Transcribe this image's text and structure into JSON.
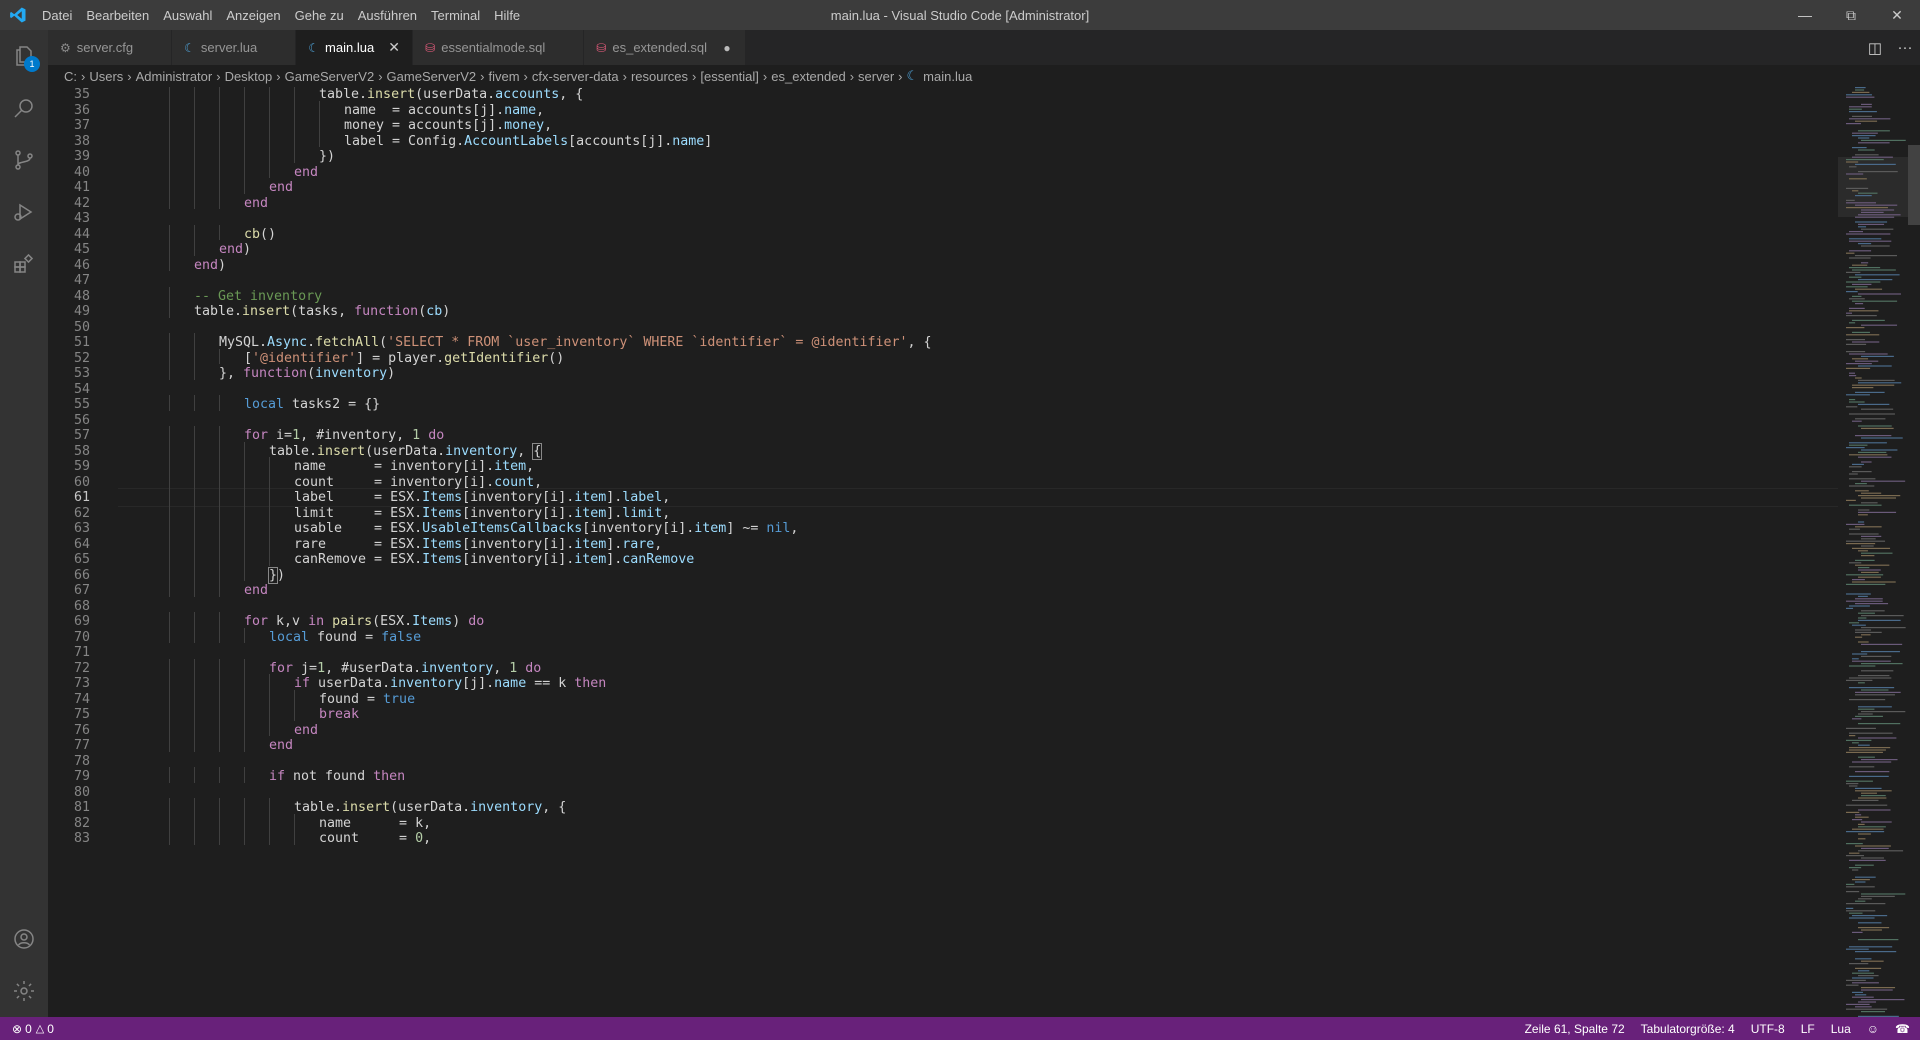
{
  "window": {
    "title": "main.lua - Visual Studio Code [Administrator]",
    "menu": [
      "Datei",
      "Bearbeiten",
      "Auswahl",
      "Anzeigen",
      "Gehe zu",
      "Ausführen",
      "Terminal",
      "Hilfe"
    ]
  },
  "activity_bar": {
    "explorer_badge": "1"
  },
  "tabs": [
    {
      "label": "server.cfg",
      "icon": "gear-icon",
      "state": "inactive"
    },
    {
      "label": "server.lua",
      "icon": "lua-moon-icon",
      "state": "inactive"
    },
    {
      "label": "main.lua",
      "icon": "lua-moon-icon",
      "state": "active"
    },
    {
      "label": "essentialmode.sql",
      "icon": "database-icon",
      "state": "inactive"
    },
    {
      "label": "es_extended.sql",
      "icon": "database-icon",
      "state": "modified"
    }
  ],
  "breadcrumb": [
    "C:",
    "Users",
    "Administrator",
    "Desktop",
    "GameServerV2",
    "GameServerV2",
    "fivem",
    "cfx-server-data",
    "resources",
    "[essential]",
    "es_extended",
    "server",
    "main.lua"
  ],
  "editor": {
    "current_line": 61,
    "lines": [
      {
        "n": "35",
        "i": 7,
        "t": [
          [
            "table",
            "id"
          ],
          [
            ".",
            "id"
          ],
          [
            "insert",
            "fn"
          ],
          [
            "(userData.",
            "id"
          ],
          [
            "accounts",
            "prop"
          ],
          [
            ", {",
            "id"
          ]
        ]
      },
      {
        "n": "36",
        "i": 8,
        "t": [
          [
            "name  = accounts[j].",
            "id"
          ],
          [
            "name",
            "prop"
          ],
          [
            ",",
            "id"
          ]
        ]
      },
      {
        "n": "37",
        "i": 8,
        "t": [
          [
            "money = accounts[j].",
            "id"
          ],
          [
            "money",
            "prop"
          ],
          [
            ",",
            "id"
          ]
        ]
      },
      {
        "n": "38",
        "i": 8,
        "t": [
          [
            "label = Config.",
            "id"
          ],
          [
            "AccountLabels",
            "prop"
          ],
          [
            "[accounts[j].",
            "id"
          ],
          [
            "name",
            "prop"
          ],
          [
            "]",
            "id"
          ]
        ]
      },
      {
        "n": "39",
        "i": 7,
        "t": [
          [
            "})",
            "id"
          ]
        ]
      },
      {
        "n": "40",
        "i": 6,
        "t": [
          [
            "end",
            "kw"
          ]
        ]
      },
      {
        "n": "41",
        "i": 5,
        "t": [
          [
            "end",
            "kw"
          ]
        ]
      },
      {
        "n": "42",
        "i": 4,
        "t": [
          [
            "end",
            "kw"
          ]
        ]
      },
      {
        "n": "43",
        "i": 0,
        "t": []
      },
      {
        "n": "44",
        "i": 4,
        "t": [
          [
            "cb",
            "fn"
          ],
          [
            "()",
            "id"
          ]
        ]
      },
      {
        "n": "45",
        "i": 3,
        "t": [
          [
            "end",
            "kw"
          ],
          [
            ")",
            "id"
          ]
        ]
      },
      {
        "n": "46",
        "i": 2,
        "t": [
          [
            "end",
            "kw"
          ],
          [
            ")",
            "id"
          ]
        ]
      },
      {
        "n": "47",
        "i": 0,
        "t": []
      },
      {
        "n": "48",
        "i": 2,
        "t": [
          [
            "-- Get inventory",
            "cm"
          ]
        ]
      },
      {
        "n": "49",
        "i": 2,
        "t": [
          [
            "table",
            "id"
          ],
          [
            ".",
            "id"
          ],
          [
            "insert",
            "fn"
          ],
          [
            "(tasks, ",
            "id"
          ],
          [
            "function",
            "kw"
          ],
          [
            "(",
            "id"
          ],
          [
            "cb",
            "prop"
          ],
          [
            ")",
            "id"
          ]
        ]
      },
      {
        "n": "50",
        "i": 0,
        "t": []
      },
      {
        "n": "51",
        "i": 3,
        "t": [
          [
            "MySQL.",
            "id"
          ],
          [
            "Async",
            "prop"
          ],
          [
            ".",
            "id"
          ],
          [
            "fetchAll",
            "fn"
          ],
          [
            "(",
            "id"
          ],
          [
            "'SELECT * FROM `user_inventory` WHERE `identifier` = @identifier'",
            "str"
          ],
          [
            ", {",
            "id"
          ]
        ]
      },
      {
        "n": "52",
        "i": 4,
        "t": [
          [
            "[",
            "id"
          ],
          [
            "'@identifier'",
            "str"
          ],
          [
            "] = player.",
            "id"
          ],
          [
            "getIdentifier",
            "fn"
          ],
          [
            "()",
            "id"
          ]
        ]
      },
      {
        "n": "53",
        "i": 3,
        "t": [
          [
            "}, ",
            "id"
          ],
          [
            "function",
            "kw"
          ],
          [
            "(",
            "id"
          ],
          [
            "inventory",
            "prop"
          ],
          [
            ")",
            "id"
          ]
        ]
      },
      {
        "n": "54",
        "i": 0,
        "t": []
      },
      {
        "n": "55",
        "i": 4,
        "t": [
          [
            "local",
            "kb"
          ],
          [
            " tasks2 = {}",
            "id"
          ]
        ]
      },
      {
        "n": "56",
        "i": 0,
        "t": []
      },
      {
        "n": "57",
        "i": 4,
        "t": [
          [
            "for",
            "kw"
          ],
          [
            " i=",
            "id"
          ],
          [
            "1",
            "num"
          ],
          [
            ", #inventory, ",
            "id"
          ],
          [
            "1",
            "num"
          ],
          [
            " ",
            "id"
          ],
          [
            "do",
            "kw"
          ]
        ]
      },
      {
        "n": "58",
        "i": 5,
        "t": [
          [
            "table",
            "id"
          ],
          [
            ".",
            "id"
          ],
          [
            "insert",
            "fn"
          ],
          [
            "(userData.",
            "id"
          ],
          [
            "inventory",
            "prop"
          ],
          [
            ", ",
            "id"
          ],
          [
            "{",
            "bc"
          ]
        ]
      },
      {
        "n": "59",
        "i": 6,
        "t": [
          [
            "name      = inventory[i].",
            "id"
          ],
          [
            "item",
            "prop"
          ],
          [
            ",",
            "id"
          ]
        ]
      },
      {
        "n": "60",
        "i": 6,
        "t": [
          [
            "count     = inventory[i].",
            "id"
          ],
          [
            "count",
            "prop"
          ],
          [
            ",",
            "id"
          ]
        ]
      },
      {
        "n": "61",
        "i": 6,
        "t": [
          [
            "label     = ESX.",
            "id"
          ],
          [
            "Items",
            "prop"
          ],
          [
            "[inventory[i].",
            "id"
          ],
          [
            "item",
            "prop"
          ],
          [
            "].",
            "id"
          ],
          [
            "label",
            "prop"
          ],
          [
            ",",
            "id"
          ]
        ]
      },
      {
        "n": "62",
        "i": 6,
        "t": [
          [
            "limit     = ESX.",
            "id"
          ],
          [
            "Items",
            "prop"
          ],
          [
            "[inventory[i].",
            "id"
          ],
          [
            "item",
            "prop"
          ],
          [
            "].",
            "id"
          ],
          [
            "limit",
            "prop"
          ],
          [
            ",",
            "id"
          ]
        ]
      },
      {
        "n": "63",
        "i": 6,
        "t": [
          [
            "usable    = ESX.",
            "id"
          ],
          [
            "UsableItemsCallbacks",
            "prop"
          ],
          [
            "[inventory[i].",
            "id"
          ],
          [
            "item",
            "prop"
          ],
          [
            "] ~= ",
            "id"
          ],
          [
            "nil",
            "kb"
          ],
          [
            ",",
            "id"
          ]
        ]
      },
      {
        "n": "64",
        "i": 6,
        "t": [
          [
            "rare      = ESX.",
            "id"
          ],
          [
            "Items",
            "prop"
          ],
          [
            "[inventory[i].",
            "id"
          ],
          [
            "item",
            "prop"
          ],
          [
            "].",
            "id"
          ],
          [
            "rare",
            "prop"
          ],
          [
            ",",
            "id"
          ]
        ]
      },
      {
        "n": "65",
        "i": 6,
        "t": [
          [
            "canRemove = ESX.",
            "id"
          ],
          [
            "Items",
            "prop"
          ],
          [
            "[inventory[i].",
            "id"
          ],
          [
            "item",
            "prop"
          ],
          [
            "].",
            "id"
          ],
          [
            "canRemove",
            "prop"
          ]
        ]
      },
      {
        "n": "66",
        "i": 5,
        "t": [
          [
            "}",
            "bc"
          ],
          [
            ")",
            "id"
          ]
        ]
      },
      {
        "n": "67",
        "i": 4,
        "t": [
          [
            "end",
            "kw"
          ]
        ]
      },
      {
        "n": "68",
        "i": 0,
        "t": []
      },
      {
        "n": "69",
        "i": 4,
        "t": [
          [
            "for",
            "kw"
          ],
          [
            " k,v ",
            "id"
          ],
          [
            "in",
            "kw"
          ],
          [
            " ",
            "id"
          ],
          [
            "pairs",
            "fn"
          ],
          [
            "(ESX.",
            "id"
          ],
          [
            "Items",
            "prop"
          ],
          [
            ") ",
            "id"
          ],
          [
            "do",
            "kw"
          ]
        ]
      },
      {
        "n": "70",
        "i": 5,
        "t": [
          [
            "local",
            "kb"
          ],
          [
            " found = ",
            "id"
          ],
          [
            "false",
            "kb"
          ]
        ]
      },
      {
        "n": "71",
        "i": 0,
        "t": []
      },
      {
        "n": "72",
        "i": 5,
        "t": [
          [
            "for",
            "kw"
          ],
          [
            " j=",
            "id"
          ],
          [
            "1",
            "num"
          ],
          [
            ", #userData.",
            "id"
          ],
          [
            "inventory",
            "prop"
          ],
          [
            ", ",
            "id"
          ],
          [
            "1",
            "num"
          ],
          [
            " ",
            "id"
          ],
          [
            "do",
            "kw"
          ]
        ]
      },
      {
        "n": "73",
        "i": 6,
        "t": [
          [
            "if",
            "kw"
          ],
          [
            " userData.",
            "id"
          ],
          [
            "inventory",
            "prop"
          ],
          [
            "[j].",
            "id"
          ],
          [
            "name",
            "prop"
          ],
          [
            " == k ",
            "id"
          ],
          [
            "then",
            "kw"
          ]
        ]
      },
      {
        "n": "74",
        "i": 7,
        "t": [
          [
            "found = ",
            "id"
          ],
          [
            "true",
            "kb"
          ]
        ]
      },
      {
        "n": "75",
        "i": 7,
        "t": [
          [
            "break",
            "kw"
          ]
        ]
      },
      {
        "n": "76",
        "i": 6,
        "t": [
          [
            "end",
            "kw"
          ]
        ]
      },
      {
        "n": "77",
        "i": 5,
        "t": [
          [
            "end",
            "kw"
          ]
        ]
      },
      {
        "n": "78",
        "i": 0,
        "t": []
      },
      {
        "n": "79",
        "i": 5,
        "t": [
          [
            "if",
            "kw"
          ],
          [
            " not found ",
            "id"
          ],
          [
            "then",
            "kw"
          ]
        ]
      },
      {
        "n": "80",
        "i": 0,
        "t": []
      },
      {
        "n": "81",
        "i": 6,
        "t": [
          [
            "table",
            "id"
          ],
          [
            ".",
            "id"
          ],
          [
            "insert",
            "fn"
          ],
          [
            "(userData.",
            "id"
          ],
          [
            "inventory",
            "prop"
          ],
          [
            ", {",
            "id"
          ]
        ]
      },
      {
        "n": "82",
        "i": 7,
        "t": [
          [
            "name      = k,",
            "id"
          ]
        ]
      },
      {
        "n": "83",
        "i": 7,
        "t": [
          [
            "count     = ",
            "id"
          ],
          [
            "0",
            "num"
          ],
          [
            ",",
            "id"
          ]
        ]
      }
    ]
  },
  "status_bar": {
    "errors": "0",
    "warnings": "0",
    "position": "Zeile 61, Spalte 72",
    "indent": "Tabulatorgröße: 4",
    "encoding": "UTF-8",
    "eol": "LF",
    "language": "Lua"
  },
  "colors": {
    "status_bar": "#68217a",
    "accent": "#007acc"
  }
}
